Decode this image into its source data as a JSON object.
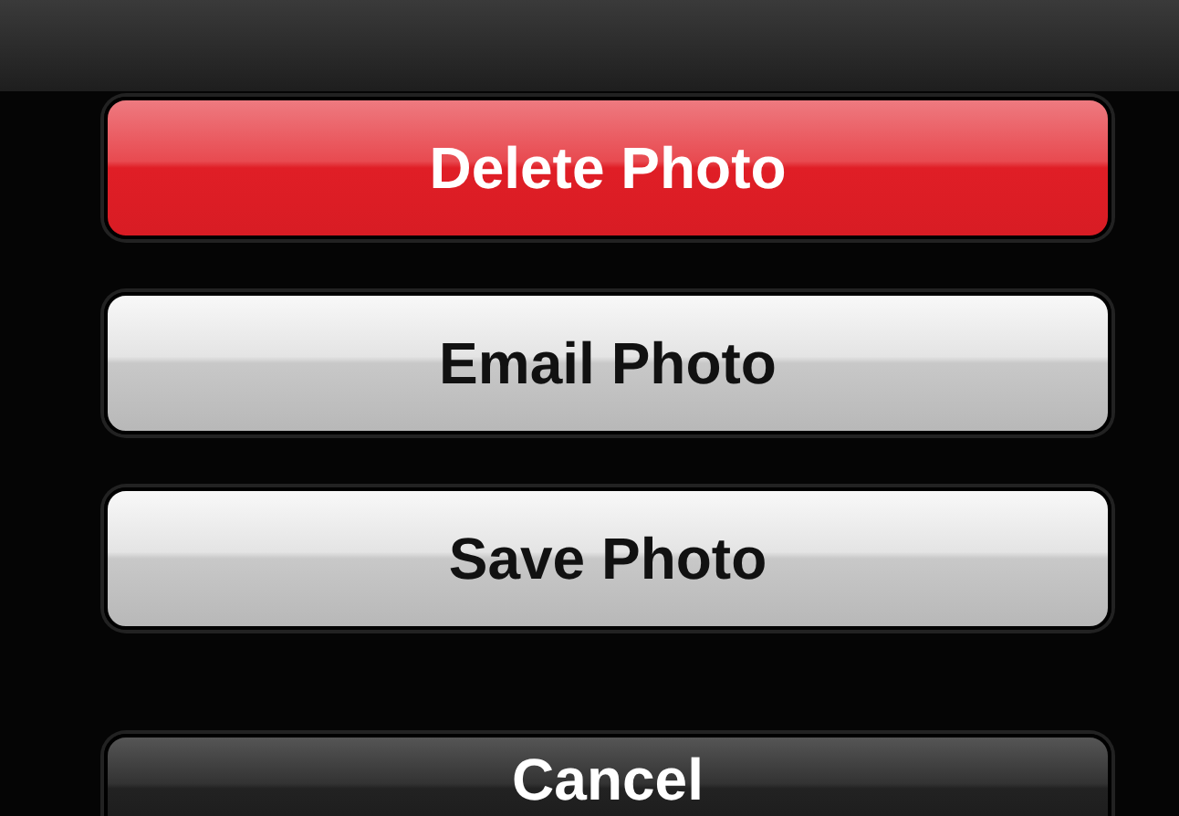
{
  "action_sheet": {
    "buttons": [
      {
        "label": "Delete Photo",
        "kind": "destructive"
      },
      {
        "label": "Email Photo",
        "kind": "default"
      },
      {
        "label": "Save Photo",
        "kind": "default"
      },
      {
        "label": "Cancel",
        "kind": "cancel"
      }
    ]
  }
}
